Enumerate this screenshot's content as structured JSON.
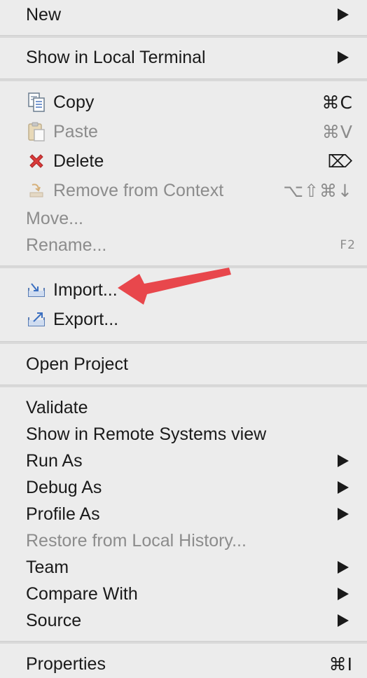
{
  "menu": {
    "new": {
      "label": "New"
    },
    "show_local_terminal": {
      "label": "Show in Local Terminal"
    },
    "copy": {
      "label": "Copy",
      "shortcut": "⌘C",
      "icon": "copy-icon"
    },
    "paste": {
      "label": "Paste",
      "shortcut": "⌘V",
      "icon": "paste-icon"
    },
    "delete": {
      "label": "Delete",
      "shortcut": "⌦",
      "icon": "delete-icon"
    },
    "remove_context": {
      "label": "Remove from Context",
      "shortcut": "⌥⇧⌘↓",
      "icon": "remove-context-icon"
    },
    "move": {
      "label": "Move..."
    },
    "rename": {
      "label": "Rename...",
      "shortcut": "F2"
    },
    "import": {
      "label": "Import...",
      "icon": "import-icon"
    },
    "export": {
      "label": "Export...",
      "icon": "export-icon"
    },
    "open_project": {
      "label": "Open Project"
    },
    "validate": {
      "label": "Validate"
    },
    "show_remote": {
      "label": "Show in Remote Systems view"
    },
    "run_as": {
      "label": "Run As"
    },
    "debug_as": {
      "label": "Debug As"
    },
    "profile_as": {
      "label": "Profile As"
    },
    "restore_history": {
      "label": "Restore from Local History..."
    },
    "team": {
      "label": "Team"
    },
    "compare_with": {
      "label": "Compare With"
    },
    "source": {
      "label": "Source"
    },
    "properties": {
      "label": "Properties",
      "shortcut": "⌘I"
    }
  },
  "colors": {
    "menu_bg": "#ececec",
    "text": "#1a1a1a",
    "disabled_text": "#8c8c8c",
    "annotation_arrow": "#e8474c"
  }
}
